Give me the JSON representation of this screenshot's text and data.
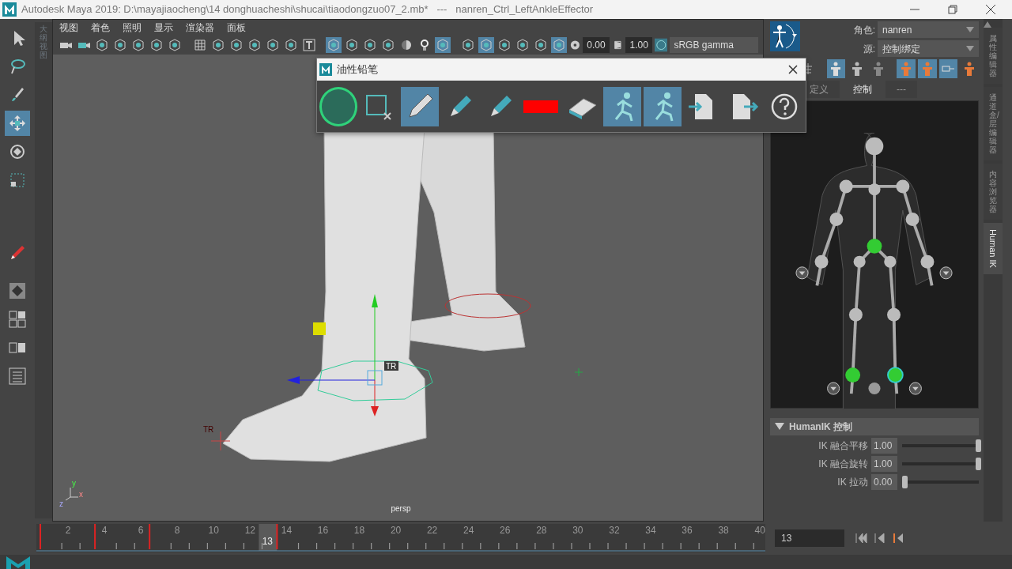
{
  "window": {
    "title": "Autodesk Maya 2019: D:\\mayajiaocheng\\14 donghuacheshi\\shucai\\tiaodongzuo07_2.mb*   ---   nanren_Ctrl_LeftAnkleEffector"
  },
  "tool_box": [
    {
      "selected": false
    },
    {
      "selected": false
    },
    {
      "selected": false
    },
    {
      "selected": true
    },
    {
      "selected": false
    },
    {
      "selected": false
    },
    {
      "selected": false
    },
    {
      "selected": false
    },
    {
      "selected": false
    },
    {
      "selected": false
    },
    {
      "selected": false
    }
  ],
  "outliner_tab": {
    "label": "大纲视图"
  },
  "viewport": {
    "menus": [
      "视图",
      "着色",
      "照明",
      "显示",
      "渲染器",
      "面板"
    ],
    "toolbar": [
      {
        "selected": false
      },
      {
        "selected": false
      },
      {
        "selected": false
      },
      {
        "selected": false
      },
      {
        "selected": false
      },
      {
        "selected": false
      },
      {
        "selected": false
      },
      {
        "selected": false
      },
      {
        "selected": false
      },
      {
        "selected": false
      },
      {
        "selected": false
      },
      {
        "selected": false
      },
      {
        "selected": false
      },
      {
        "selected": false
      },
      {
        "selected": true
      },
      {
        "selected": false
      },
      {
        "selected": false
      },
      {
        "selected": false
      },
      {
        "selected": false
      },
      {
        "selected": false
      },
      {
        "selected": true
      },
      {
        "selected": false
      },
      {
        "selected": true
      },
      {
        "selected": false
      },
      {
        "selected": false
      },
      {
        "selected": false
      },
      {
        "selected": true
      }
    ],
    "exposure": "0.00",
    "gamma": "1.00",
    "color_space": "sRGB gamma",
    "camera": "persp",
    "handle_labels": [
      "TR",
      "TR"
    ],
    "axes": [
      "y",
      "x",
      "z"
    ]
  },
  "pencil_window": {
    "title": "油性铅笔",
    "tools": [
      {
        "kind": "blank",
        "selected": false,
        "clicked": true
      },
      {
        "kind": "frame",
        "selected": false,
        "clicked": false
      },
      {
        "kind": "pencil",
        "selected": true,
        "clicked": false
      },
      {
        "kind": "marker",
        "selected": false,
        "clicked": false
      },
      {
        "kind": "marker",
        "selected": false,
        "clicked": false
      },
      {
        "kind": "swatch",
        "selected": false,
        "clicked": false,
        "color": "#ff0000"
      },
      {
        "kind": "eraser",
        "selected": false,
        "clicked": false
      },
      {
        "kind": "runner",
        "selected": true,
        "clicked": false
      },
      {
        "kind": "runner",
        "selected": true,
        "clicked": false
      },
      {
        "kind": "import",
        "selected": false,
        "clicked": false
      },
      {
        "kind": "export",
        "selected": false,
        "clicked": false
      },
      {
        "kind": "help",
        "selected": false,
        "clicked": false
      }
    ]
  },
  "hik": {
    "character_label": "角色:",
    "character": "nanren",
    "source_label": "源:",
    "source": "控制绑定",
    "tools": [
      {
        "selected": false
      },
      {
        "selected": true
      },
      {
        "selected": false
      },
      {
        "selected": false
      },
      {
        "selected": true
      },
      {
        "selected": true
      },
      {
        "selected": true
      },
      {
        "selected": false
      }
    ],
    "tabs": [
      {
        "label": "定义",
        "selected": false
      },
      {
        "label": "控制",
        "selected": true
      },
      {
        "label": "---",
        "selected": false
      }
    ],
    "section": {
      "title": "HumanIK 控制",
      "expanded": true
    },
    "sliders": [
      {
        "label": "IK 融合平移",
        "value": "1.00",
        "level": 1
      },
      {
        "label": "IK 融合旋转",
        "value": "1.00",
        "level": 1
      },
      {
        "label": "IK 拉动",
        "value": "0.00",
        "level": 0
      }
    ]
  },
  "side_tabs": [
    {
      "label": "属性编辑器",
      "kind": "cjk",
      "selected": false
    },
    {
      "label": "通道盒/层编辑器",
      "kind": "cjk",
      "selected": false
    },
    {
      "label": "内容浏览器",
      "kind": "cjk",
      "selected": false
    },
    {
      "label": "Human IK",
      "kind": "latin",
      "selected": true
    }
  ],
  "timeline": {
    "ticks": [
      "2",
      "4",
      "6",
      "8",
      "10",
      "12",
      "14",
      "16",
      "18",
      "20",
      "22",
      "24",
      "26",
      "28",
      "30",
      "32",
      "34",
      "36",
      "38",
      "40"
    ],
    "frames": [
      {
        "key": true
      },
      {
        "key": false
      },
      {
        "key": false
      },
      {
        "key": true
      },
      {
        "key": false
      },
      {
        "key": false
      },
      {
        "key": true
      },
      {
        "key": false
      },
      {
        "key": false
      },
      {
        "key": false
      },
      {
        "key": false
      },
      {
        "key": false
      },
      {
        "key": false
      },
      {
        "key": true
      },
      {
        "key": false
      },
      {
        "key": false
      },
      {
        "key": false
      },
      {
        "key": false
      },
      {
        "key": false
      },
      {
        "key": false
      },
      {
        "key": false
      },
      {
        "key": false
      },
      {
        "key": false
      },
      {
        "key": false
      },
      {
        "key": false
      },
      {
        "key": false
      },
      {
        "key": false
      },
      {
        "key": false
      },
      {
        "key": false
      },
      {
        "key": false
      },
      {
        "key": false
      },
      {
        "key": false
      },
      {
        "key": false
      },
      {
        "key": false
      },
      {
        "key": false
      },
      {
        "key": false
      },
      {
        "key": false
      },
      {
        "key": false
      },
      {
        "key": false
      },
      {
        "key": false
      }
    ],
    "current": "13",
    "frame_field": "13"
  }
}
